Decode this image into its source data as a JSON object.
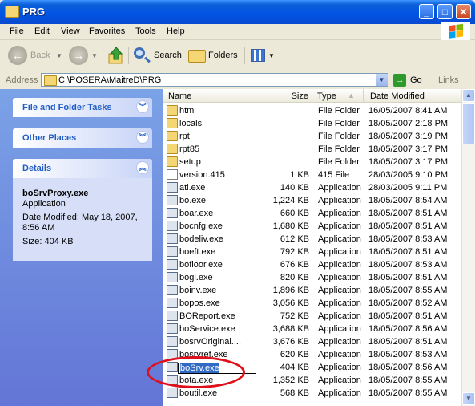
{
  "window": {
    "title": "PRG",
    "controls": {
      "minimize": "_",
      "maximize": "□",
      "close": "✕"
    }
  },
  "menu": [
    "File",
    "Edit",
    "View",
    "Favorites",
    "Tools",
    "Help"
  ],
  "toolbar": {
    "back_label": "Back",
    "search_label": "Search",
    "folders_label": "Folders"
  },
  "address": {
    "label": "Address",
    "value": "C:\\POSERA\\MaitreD\\PRG",
    "go_label": "Go",
    "links_label": "Links"
  },
  "sidebar": {
    "panels": [
      {
        "title": "File and Folder Tasks",
        "state": "collapsed"
      },
      {
        "title": "Other Places",
        "state": "collapsed"
      },
      {
        "title": "Details",
        "state": "expanded"
      }
    ],
    "details": {
      "name": "boSrvProxy.exe",
      "type": "Application",
      "modified_line1": "Date Modified: May 18, 2007,",
      "modified_line2": "8:56 AM",
      "size": "Size: 404 KB"
    }
  },
  "columns": {
    "name": "Name",
    "size": "Size",
    "type": "Type",
    "date": "Date Modified"
  },
  "files": [
    {
      "name": "htm",
      "size": "",
      "type": "File Folder",
      "date": "16/05/2007 8:41 AM",
      "icon": "folder-icon"
    },
    {
      "name": "locals",
      "size": "",
      "type": "File Folder",
      "date": "18/05/2007 2:18 PM",
      "icon": "folder-icon"
    },
    {
      "name": "rpt",
      "size": "",
      "type": "File Folder",
      "date": "18/05/2007 3:19 PM",
      "icon": "folder-icon"
    },
    {
      "name": "rpt85",
      "size": "",
      "type": "File Folder",
      "date": "18/05/2007 3:17 PM",
      "icon": "folder-icon"
    },
    {
      "name": "setup",
      "size": "",
      "type": "File Folder",
      "date": "18/05/2007 3:17 PM",
      "icon": "folder-icon"
    },
    {
      "name": "version.415",
      "size": "1 KB",
      "type": "415 File",
      "date": "28/03/2005 9:10 PM",
      "icon": "file-icon"
    },
    {
      "name": "atl.exe",
      "size": "140 KB",
      "type": "Application",
      "date": "28/03/2005 9:11 PM",
      "icon": "application-icon"
    },
    {
      "name": "bo.exe",
      "size": "1,224 KB",
      "type": "Application",
      "date": "18/05/2007 8:54 AM",
      "icon": "application-icon"
    },
    {
      "name": "boar.exe",
      "size": "660 KB",
      "type": "Application",
      "date": "18/05/2007 8:51 AM",
      "icon": "application-icon"
    },
    {
      "name": "bocnfg.exe",
      "size": "1,680 KB",
      "type": "Application",
      "date": "18/05/2007 8:51 AM",
      "icon": "application-icon"
    },
    {
      "name": "bodeliv.exe",
      "size": "612 KB",
      "type": "Application",
      "date": "18/05/2007 8:53 AM",
      "icon": "application-icon"
    },
    {
      "name": "boeft.exe",
      "size": "792 KB",
      "type": "Application",
      "date": "18/05/2007 8:51 AM",
      "icon": "application-icon"
    },
    {
      "name": "bofloor.exe",
      "size": "676 KB",
      "type": "Application",
      "date": "18/05/2007 8:53 AM",
      "icon": "application-icon"
    },
    {
      "name": "bogl.exe",
      "size": "820 KB",
      "type": "Application",
      "date": "18/05/2007 8:51 AM",
      "icon": "application-icon"
    },
    {
      "name": "boinv.exe",
      "size": "1,896 KB",
      "type": "Application",
      "date": "18/05/2007 8:55 AM",
      "icon": "application-icon"
    },
    {
      "name": "bopos.exe",
      "size": "3,056 KB",
      "type": "Application",
      "date": "18/05/2007 8:52 AM",
      "icon": "application-icon"
    },
    {
      "name": "BOReport.exe",
      "size": "752 KB",
      "type": "Application",
      "date": "18/05/2007 8:51 AM",
      "icon": "application-icon"
    },
    {
      "name": "boService.exe",
      "size": "3,688 KB",
      "type": "Application",
      "date": "18/05/2007 8:56 AM",
      "icon": "application-icon"
    },
    {
      "name": "bosrvOriginal....",
      "size": "3,676 KB",
      "type": "Application",
      "date": "18/05/2007 8:51 AM",
      "icon": "application-icon"
    },
    {
      "name": "bosrvref.exe",
      "size": "620 KB",
      "type": "Application",
      "date": "18/05/2007 8:53 AM",
      "icon": "application-icon"
    },
    {
      "name": "boSrv.exe",
      "size": "404 KB",
      "type": "Application",
      "date": "18/05/2007 8:56 AM",
      "icon": "application-icon",
      "selected": true,
      "renaming": true
    },
    {
      "name": "bota.exe",
      "size": "1,352 KB",
      "type": "Application",
      "date": "18/05/2007 8:55 AM",
      "icon": "application-icon"
    },
    {
      "name": "boutil.exe",
      "size": "568 KB",
      "type": "Application",
      "date": "18/05/2007 8:55 AM",
      "icon": "application-icon"
    }
  ],
  "colors": {
    "title_bar": "#0054e3",
    "sidebar": "#6375d6",
    "selection": "#316ac5",
    "annotation": "#e0101a"
  }
}
